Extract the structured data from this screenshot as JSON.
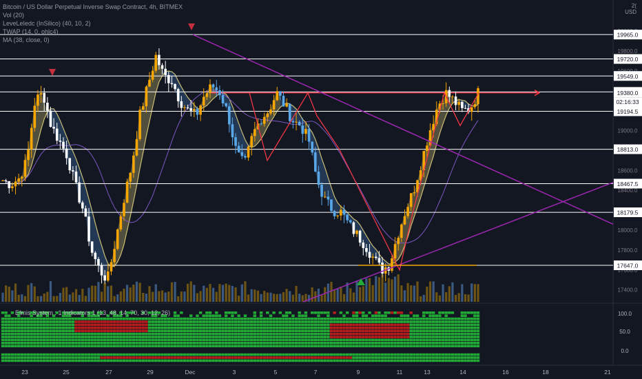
{
  "header": {
    "title": "Bitcoin / US Dollar Perpetual Inverse Swap Contract, 4h, BITMEX",
    "indicators": [
      "Vol (20)",
      "LeveLeIedc (InSilico) (40, 10, 2)",
      "TWAP (14, 0, ohlc4)",
      "MA (38, close, 0)"
    ],
    "currency_top": "2(",
    "currency": "USD"
  },
  "lower_indicator_label": "Efmis System : 1 Indicators 1 (13, 48, 14, 70, 30, 12, 26)",
  "colors": {
    "background": "#131722",
    "level_line": "#ffffff",
    "resistance": "#f23645",
    "trend": "#9c27b0",
    "up_candle": "#f7a600",
    "down_candle": "#ffffff",
    "cloud_up": "#f4e185",
    "cloud_down": "#4a90d9",
    "band_green": "#22ab36",
    "band_red": "#b71c1c"
  },
  "chart_data": {
    "type": "candlestick",
    "x_tick_labels": [
      "23",
      "25",
      "27",
      "29",
      "Dec",
      "3",
      "5",
      "7",
      "9",
      "11",
      "13",
      "14",
      "16",
      "18",
      "21"
    ],
    "price_axis_labels": [
      "20000.0",
      "19800.0",
      "19600.0",
      "19400.0",
      "19200.0",
      "19000.0",
      "18800.0",
      "18600.0",
      "18400.0",
      "18200.0",
      "18000.0",
      "17800.0",
      "17600.0",
      "17400.0"
    ],
    "price_range": [
      17280,
      20160
    ],
    "horizontal_levels": [
      19965.0,
      19720.0,
      19549.0,
      19389.0,
      19194.5,
      18813.0,
      18467.5,
      18179.5,
      17647.0
    ],
    "current_price": "19380.0",
    "countdown": "02:16:33",
    "oscillator_axis_labels": [
      "100.0",
      "50.0",
      "0.0"
    ],
    "resistance_level": 19380,
    "close_path": [
      18500,
      18460,
      18520,
      18700,
      19300,
      19380,
      19050,
      18900,
      18750,
      18450,
      18200,
      17800,
      17600,
      17500,
      17900,
      18300,
      18650,
      19150,
      19450,
      19750,
      19550,
      19500,
      19300,
      19200,
      19150,
      19350,
      19450,
      19380,
      19150,
      18780,
      18650,
      18950,
      19120,
      19200,
      19380,
      19250,
      19100,
      19050,
      18900,
      18500,
      18300,
      18200,
      18180,
      18050,
      17950,
      17850,
      17720,
      17600,
      17650,
      17950,
      18200,
      18400,
      18700,
      19000,
      19250,
      19380,
      19300,
      19200,
      19220,
      19380
    ]
  }
}
